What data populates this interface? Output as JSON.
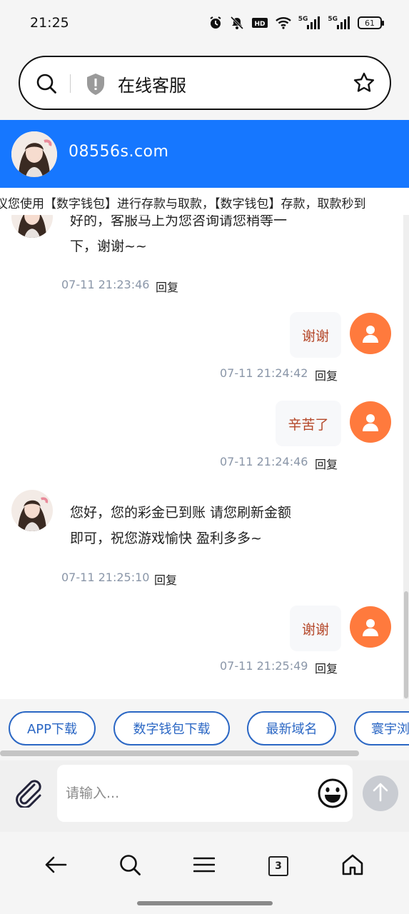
{
  "status_bar": {
    "time": "21:25",
    "network_1": "5G",
    "network_2": "5G",
    "hd_label": "HD",
    "battery": "61",
    "icons": [
      "alarm-icon",
      "mute-icon",
      "hd-icon",
      "wifi-icon",
      "signal-icon",
      "signal-icon",
      "battery-icon"
    ]
  },
  "address_bar": {
    "title": "在线客服",
    "icons": [
      "search-icon",
      "shield-icon",
      "star-icon"
    ]
  },
  "header": {
    "domain": "08556s.com",
    "brand_color": "#1677ff"
  },
  "marquee": {
    "text": "议您使用【数字钱包】进行存款与取款，【数字钱包】存款，取款秒到"
  },
  "messages": [
    {
      "side": "left",
      "line1": "好的，客服马上为您咨询请您稍等一",
      "line2": "下，谢谢~~",
      "time": "07-11 21:23:46",
      "reply": "回复"
    },
    {
      "side": "right",
      "text": "谢谢",
      "time": "07-11 21:24:42",
      "reply": "回复"
    },
    {
      "side": "right",
      "text": "辛苦了",
      "time": "07-11 21:24:46",
      "reply": "回复"
    },
    {
      "side": "left",
      "line1": "您好，您的彩金已到账 请您刷新金额",
      "line2": "即可，祝您游戏愉快 盈利多多~",
      "time": "07-11 21:25:10",
      "reply": "回复"
    },
    {
      "side": "right",
      "text": "谢谢",
      "time": "07-11 21:25:49",
      "reply": "回复"
    }
  ],
  "quick_buttons": [
    "APP下载",
    "数字钱包下载",
    "最新域名",
    "寰宇浏"
  ],
  "input": {
    "placeholder": "请输入...",
    "icons": [
      "paperclip-icon",
      "emoji-icon",
      "send-arrow-icon"
    ]
  },
  "bottom_nav": {
    "tab_count": "3",
    "icons": [
      "back-arrow-icon",
      "search-icon",
      "menu-icon",
      "tabs-icon",
      "home-icon"
    ]
  },
  "colors": {
    "accent": "#1677ff",
    "user_avatar": "#ff7a3d",
    "user_text": "#b5482a",
    "quick_button": "#2b67c4",
    "timestamp": "#8a96a8"
  }
}
